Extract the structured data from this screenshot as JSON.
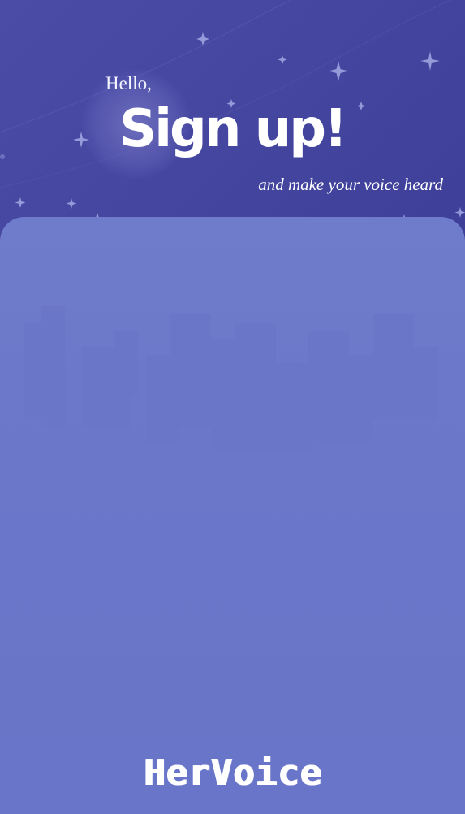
{
  "header": {
    "greeting": "Hello,",
    "title": "Sign up!",
    "subtitle": "and make your voice heard"
  },
  "brand": {
    "logo_text": "HerVoice"
  },
  "colors": {
    "header_bg": "#4446a0",
    "panel_bg": "#6b77c9",
    "text": "#ffffff"
  }
}
